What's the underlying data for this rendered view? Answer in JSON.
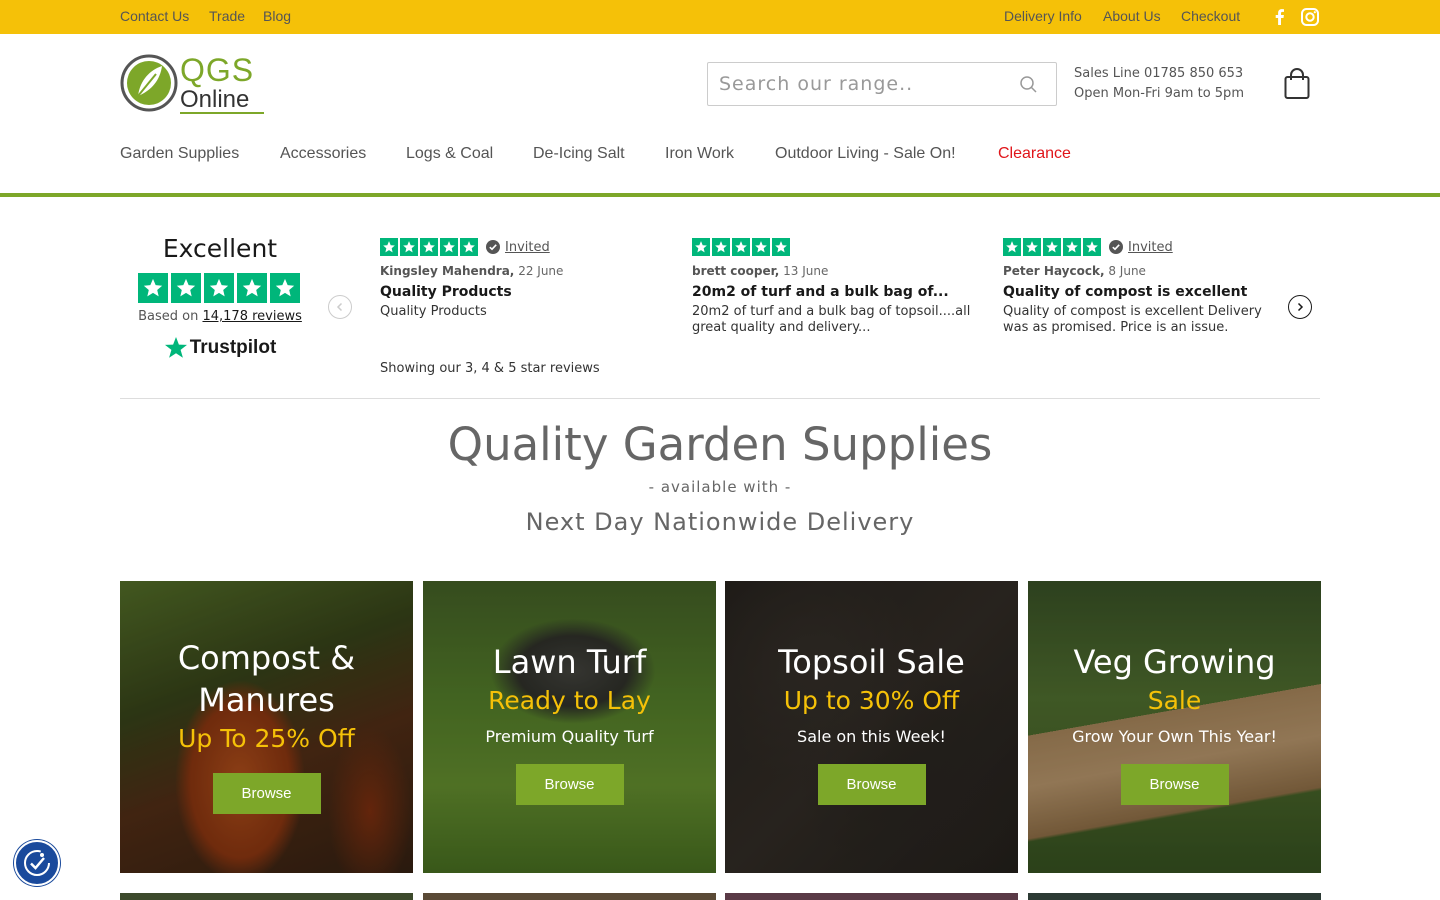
{
  "topbar": {
    "left_links": [
      "Contact Us",
      "Trade",
      "Blog"
    ],
    "right_links": [
      "Delivery Info",
      "About Us",
      "Checkout"
    ],
    "social": [
      "facebook-icon",
      "instagram-icon"
    ]
  },
  "logo": {
    "line1": "QGS",
    "line2": "Online"
  },
  "search": {
    "placeholder": "Search our range.."
  },
  "sales": {
    "line1": "Sales Line 01785 850 653",
    "line2": "Open Mon-Fri 9am to 5pm"
  },
  "nav": {
    "items": [
      "Garden Supplies",
      "Accessories",
      "Logs & Coal",
      "De-Icing Salt",
      "Iron Work",
      "Outdoor Living - Sale On!",
      "Clearance"
    ]
  },
  "trustpilot": {
    "rating_word": "Excellent",
    "based_on_prefix": "Based on",
    "review_count": "14,178 reviews",
    "brand": "Trustpilot",
    "showing": "Showing our 3, 4 & 5 star reviews",
    "reviews": [
      {
        "invited": "Invited",
        "author": "Kingsley Mahendra,",
        "date": "22 June",
        "title": "Quality Products",
        "body": "Quality Products"
      },
      {
        "invited": "",
        "author": "brett cooper,",
        "date": "13 June",
        "title": "20m2 of turf and a bulk bag of...",
        "body": "20m2 of turf and a bulk bag of topsoil....all great quality and delivery..."
      },
      {
        "invited": "Invited",
        "author": "Peter Haycock,",
        "date": "8 June",
        "title": "Quality of compost is excellent",
        "body": "Quality of compost is excellent Delivery was as promised. Price is an issue."
      }
    ]
  },
  "hero": {
    "title": "Quality Garden Supplies",
    "subtitle": "- available with -",
    "tagline": "Next Day Nationwide Delivery"
  },
  "tiles": [
    {
      "title": "Compost & Manures",
      "highlight": "Up To 25% Off",
      "caption": "",
      "button": "Browse"
    },
    {
      "title": "Lawn Turf",
      "highlight": "Ready to Lay",
      "caption": "Premium Quality Turf",
      "button": "Browse"
    },
    {
      "title": "Topsoil Sale",
      "highlight": "Up to 30% Off",
      "caption": "Sale on this Week!",
      "button": "Browse"
    },
    {
      "title": "Veg Growing",
      "highlight": "Sale",
      "caption": "Grow Your Own This Year!",
      "button": "Browse"
    }
  ],
  "colors": {
    "topbar": "#f5c108",
    "brand_green": "#7da729",
    "clearance_red": "#e0151a",
    "trustpilot_green": "#00b67a",
    "highlight_yellow": "#f5c108"
  }
}
